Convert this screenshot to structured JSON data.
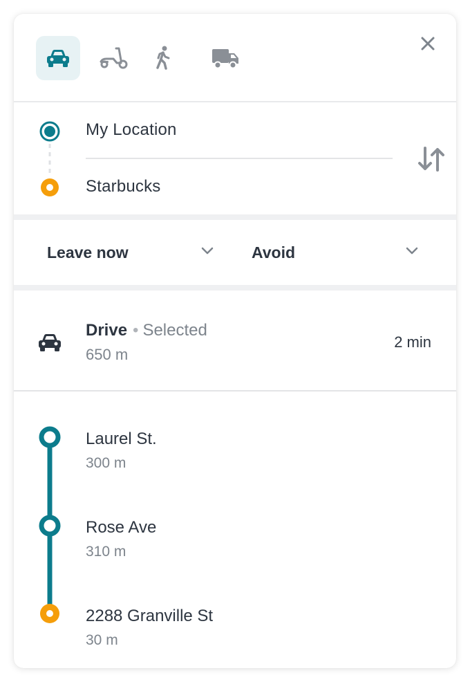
{
  "modes": [
    {
      "name": "car",
      "icon": "car-icon",
      "active": true
    },
    {
      "name": "scooter",
      "icon": "scooter-icon",
      "active": false
    },
    {
      "name": "walk",
      "icon": "walk-icon",
      "active": false
    },
    {
      "name": "truck",
      "icon": "truck-icon",
      "active": false
    }
  ],
  "close": {
    "icon": "close-icon"
  },
  "route": {
    "origin": "My Location",
    "destination": "Starbucks",
    "swap_icon": "swap-icon"
  },
  "options": {
    "time": "Leave now",
    "avoid": "Avoid"
  },
  "selected_route": {
    "mode": "Drive",
    "separator": "•",
    "status": "Selected",
    "distance": "650 m",
    "duration": "2 min"
  },
  "steps": [
    {
      "name": "Laurel St.",
      "distance": "300 m"
    },
    {
      "name": "Rose Ave",
      "distance": "310 m"
    },
    {
      "name": "2288 Granville St",
      "distance": "30 m"
    }
  ],
  "colors": {
    "accent": "#0c7c8c",
    "destination": "#f59e0b",
    "active_mode_bg": "#e7f2f4",
    "icon_gray": "#8a8f96",
    "text": "#2d3540",
    "muted": "#7d848c"
  }
}
